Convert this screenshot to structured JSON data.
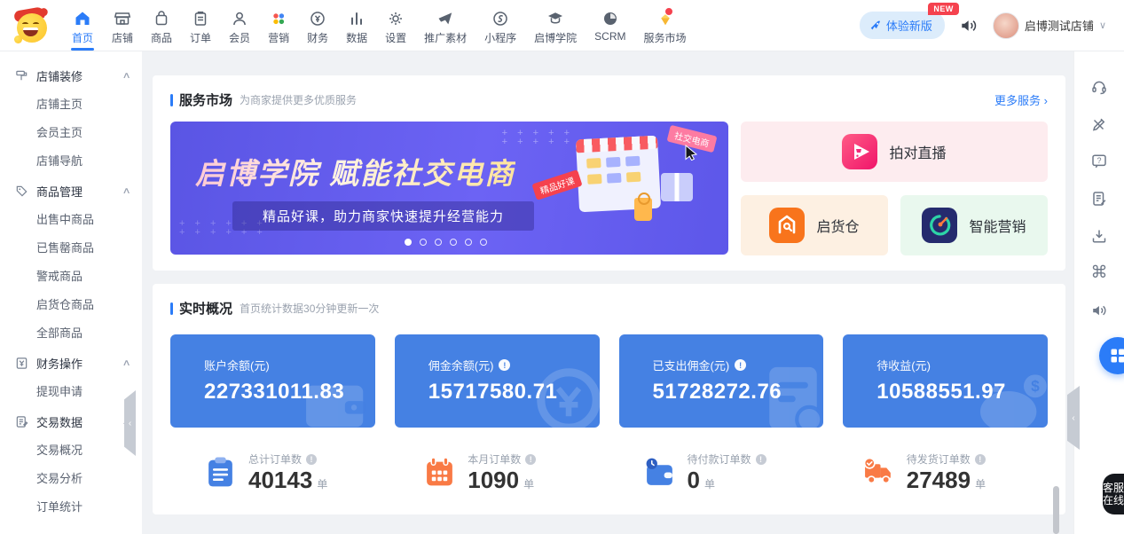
{
  "colors": {
    "accent": "#2b7cf8",
    "balance_card": "#4581e3",
    "orange": "#f97a45",
    "red_badge": "#f5424e",
    "banner_gradient": [
      "#5a55e4",
      "#6c63f4"
    ],
    "live_pink": "#f5246b",
    "warehouse_orange": "#f8741c",
    "smart_navy": "#252b6e",
    "smart_green": "#2dd4a7"
  },
  "nav": {
    "items": [
      {
        "label": "首页",
        "icon": "home-icon",
        "active": true
      },
      {
        "label": "店铺",
        "icon": "store-icon"
      },
      {
        "label": "商品",
        "icon": "goods-icon"
      },
      {
        "label": "订单",
        "icon": "order-icon"
      },
      {
        "label": "会员",
        "icon": "member-icon"
      },
      {
        "label": "营销",
        "icon": "marketing-icon"
      },
      {
        "label": "财务",
        "icon": "finance-icon"
      },
      {
        "label": "数据",
        "icon": "data-icon"
      },
      {
        "label": "设置",
        "icon": "settings-icon"
      },
      {
        "label": "推广素材",
        "icon": "promo-icon"
      },
      {
        "label": "小程序",
        "icon": "miniprogram-icon"
      },
      {
        "label": "启博学院",
        "icon": "academy-icon"
      },
      {
        "label": "SCRM",
        "icon": "scrm-icon"
      },
      {
        "label": "服务市场",
        "icon": "service-market-icon",
        "badge": true
      }
    ],
    "right": {
      "try_new": "体验新版",
      "new_badge": "NEW",
      "shop_name": "启博测试店铺"
    }
  },
  "sidebar": {
    "groups": [
      {
        "label": "店铺装修",
        "children": [
          "店铺主页",
          "会员主页",
          "店铺导航"
        ]
      },
      {
        "label": "商品管理",
        "children": [
          "出售中商品",
          "已售罄商品",
          "警戒商品",
          "启货仓商品",
          "全部商品"
        ]
      },
      {
        "label": "财务操作",
        "children": [
          "提现申请"
        ]
      },
      {
        "label": "交易数据",
        "children": [
          "交易概况",
          "交易分析",
          "订单统计"
        ]
      }
    ]
  },
  "service_section": {
    "title": "服务市场",
    "desc": "为商家提供更多优质服务",
    "more": "更多服务",
    "more_arrow": "›",
    "banner": {
      "title": "启博学院 赋能社交电商",
      "subtitle": "精品好课，助力商家快速提升经营能力",
      "tag_right": "社交电商",
      "tag_left": "精品好课",
      "dots_total": 6,
      "dot_active_index": 0
    },
    "cards": [
      {
        "label": "拍对直播",
        "icon": "live-icon"
      },
      {
        "label": "启货仓",
        "icon": "warehouse-icon"
      },
      {
        "label": "智能营销",
        "icon": "smart-marketing-icon"
      }
    ]
  },
  "realtime_section": {
    "title": "实时概况",
    "desc": "首页统计数据30分钟更新一次",
    "balance_cards": [
      {
        "label": "账户余额(元)",
        "value": "227331011.83",
        "info": false,
        "watermark": "wallet-icon"
      },
      {
        "label": "佣金余额(元)",
        "value": "15717580.71",
        "info": true,
        "watermark": "coin-icon"
      },
      {
        "label": "已支出佣金(元)",
        "value": "51728272.76",
        "info": true,
        "watermark": "receipt-icon"
      },
      {
        "label": "待收益(元)",
        "value": "10588551.97",
        "info": false,
        "watermark": "piggy-bank-icon"
      }
    ],
    "order_stats": [
      {
        "label": "总计订单数",
        "value": "40143",
        "unit": "单",
        "icon": "clipboard-icon"
      },
      {
        "label": "本月订单数",
        "value": "1090",
        "unit": "单",
        "icon": "calendar-icon"
      },
      {
        "label": "待付款订单数",
        "value": "0",
        "unit": "单",
        "icon": "wallet-clock-icon"
      },
      {
        "label": "待发货订单数",
        "value": "27489",
        "unit": "单",
        "icon": "truck-icon"
      }
    ]
  },
  "right_strip": {
    "icons": [
      "headset-icon",
      "edit-tools-icon",
      "question-icon",
      "survey-icon",
      "download-icon",
      "command-icon",
      "horn-icon"
    ],
    "customer_service": "客服在线"
  }
}
